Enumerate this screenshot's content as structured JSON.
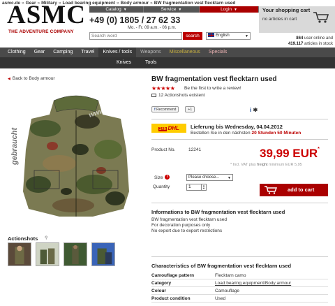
{
  "breadcrumb": {
    "items": [
      "asmc.de",
      "Gear",
      "Military",
      "Load bearing equipment",
      "Body armour",
      "BW fragmentation vest flecktarn used"
    ],
    "separator": "»"
  },
  "logo": {
    "text": "ASMC",
    "tagline": "THE ADVENTURE COMPANY"
  },
  "topnav": {
    "items": [
      "Catalog",
      "Service",
      "Login"
    ]
  },
  "contact": {
    "phone": "+49 (0) 1805 / 27 62 33",
    "hours": "Mo. - Fr. 09 a.m. - 06 p.m."
  },
  "search": {
    "placeholder": "Search word",
    "button": "search"
  },
  "language": {
    "selected": "English"
  },
  "cart": {
    "title": "Your shopping cart",
    "status": "no articles in cart"
  },
  "stats": {
    "users_count": "864",
    "users_label": "user online and",
    "articles_count": "419.117",
    "articles_label": "articles in stock"
  },
  "mainnav": {
    "items": [
      "Clothing",
      "Gear",
      "Camping",
      "Travel",
      "Knives / tools",
      "Weapons",
      "Miscellaneous",
      "Specials"
    ],
    "active": "Knives / tools"
  },
  "subnav": {
    "items": [
      "Knives",
      "Tools"
    ]
  },
  "back_link": "Back to Body armour",
  "watermark": {
    "vertical": "gebraucht",
    "diagonal": "www.asmc.de"
  },
  "actionshots": {
    "title": "Actionshots"
  },
  "product": {
    "title": "BW fragmentation vest flecktarn used",
    "rating_stars": 5,
    "review_link": "Be the first to write a review!",
    "actionshots_count": "12 Actionshots existent",
    "recommend": "Recommend",
    "plusone": "+1",
    "delivery_title": "Lieferung bis Wednesday, 04.04.2012",
    "delivery_sub_prefix": "Bestellen Sie in den nächsten",
    "delivery_sub_time": "20 Stunden 50 Minuten",
    "dhl_label": "DHL",
    "dhl_badge": "24h",
    "product_no_label": "Product No.",
    "product_no": "12241",
    "price": "39,99 EUR",
    "vat_prefix": "* Incl. VAT plus",
    "vat_freight": "freight",
    "vat_suffix": "minimum EUR 5,95",
    "size_label": "Size",
    "size_placeholder": "Please choose...",
    "qty_label": "Quantity",
    "qty_value": "1",
    "add_to_cart": "add to cart"
  },
  "info": {
    "title": "Informations to BW fragmentation vest flecktarn used",
    "lines": [
      "BW fragmentation vest flecktarn used",
      "For decoration purposes only",
      "No export due to export restrictions"
    ]
  },
  "characteristics": {
    "title": "Characteristics of BW fragmentation vest flecktarn used",
    "rows": [
      {
        "key": "Camouflage pattern",
        "value": "Flecktarn camo"
      },
      {
        "key": "Category",
        "value": "Load bearing equipment/Body armour"
      },
      {
        "key": "Colour",
        "value": "Camouflage"
      },
      {
        "key": "Product condition",
        "value": "Used"
      }
    ]
  },
  "colors": {
    "accent": "#aa0000",
    "nav_bg": "#4a4a4a",
    "dhl_yellow": "#ffcc00"
  }
}
